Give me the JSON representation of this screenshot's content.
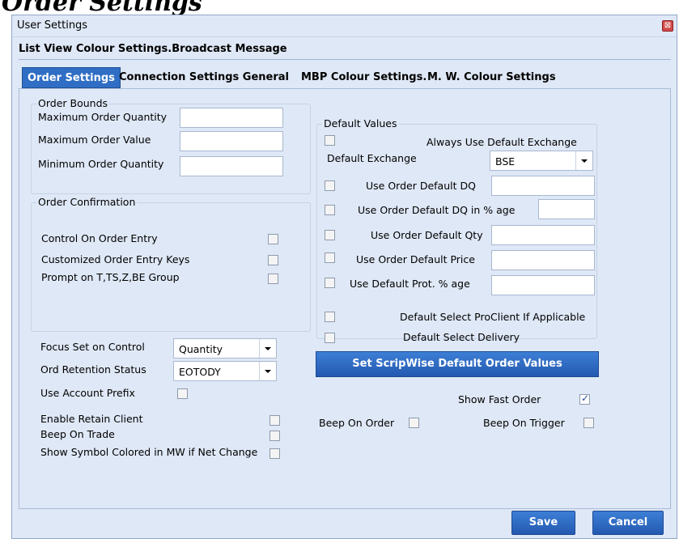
{
  "background_title": "Order Settings",
  "window": {
    "title": "User Settings",
    "close_glyph": "⊠"
  },
  "menu": {
    "label": "List View Colour Settings.Broadcast Message"
  },
  "tabs": [
    {
      "label": "Order Settings",
      "active": true
    },
    {
      "label": "Connection Settings General",
      "active": false
    },
    {
      "label": "MBP Colour Settings.",
      "active": false
    },
    {
      "label": "M. W. Colour Settings",
      "active": false
    }
  ],
  "order_bounds": {
    "legend": "Order Bounds",
    "fields": [
      {
        "label": "Maximum Order Quantity",
        "value": ""
      },
      {
        "label": "Maximum Order Value",
        "value": ""
      },
      {
        "label": "Minimum Order Quantity",
        "value": ""
      }
    ]
  },
  "order_confirmation": {
    "legend": "Order Confirmation",
    "items": [
      {
        "label": "Control On Order Entry",
        "checked": false
      },
      {
        "label": "Customized Order Entry Keys",
        "checked": false
      },
      {
        "label": "Prompt on T,TS,Z,BE Group",
        "checked": false
      }
    ]
  },
  "focus_set": {
    "label": "Focus Set on Control",
    "value": "Quantity"
  },
  "ord_retention": {
    "label": "Ord Retention Status",
    "value": "EOTODY"
  },
  "use_account_prefix": {
    "label": "Use Account Prefix",
    "checked": false
  },
  "left_checks": [
    {
      "label": "Enable Retain Client",
      "checked": false
    },
    {
      "label": "Beep On Trade",
      "checked": false
    },
    {
      "label": "Show Symbol Colored in MW if Net Change",
      "checked": false
    }
  ],
  "default_values": {
    "legend": "Default Values",
    "always_use_default_exchange": {
      "label": "Always Use Default Exchange",
      "checked": false
    },
    "default_exchange": {
      "label": "Default Exchange",
      "value": "BSE"
    },
    "rows": [
      {
        "label": "Use Order Default DQ",
        "checked": false,
        "value": ""
      },
      {
        "label": "Use Order Default DQ in % age",
        "checked": false,
        "value": ""
      },
      {
        "label": "Use Order Default Qty",
        "checked": false,
        "value": ""
      },
      {
        "label": "Use Order Default Price",
        "checked": false,
        "value": ""
      },
      {
        "label": "Use Default Prot. % age",
        "checked": false,
        "value": ""
      }
    ],
    "proclient": {
      "label": "Default Select ProClient If Applicable",
      "checked": false
    },
    "delivery": {
      "label": "Default Select Delivery",
      "checked": false
    }
  },
  "scripwise_button": "Set ScripWise Default Order Values",
  "show_fast_order": {
    "label": "Show Fast Order",
    "checked": true
  },
  "beep_on_order": {
    "label": "Beep On Order",
    "checked": false
  },
  "beep_on_trigger": {
    "label": "Beep On Trigger",
    "checked": false
  },
  "buttons": {
    "save": "Save",
    "cancel": "Cancel"
  },
  "colors": {
    "accent": "#2f6ec4",
    "window_bg": "#dfe8f6",
    "close": "#d24a4a"
  }
}
